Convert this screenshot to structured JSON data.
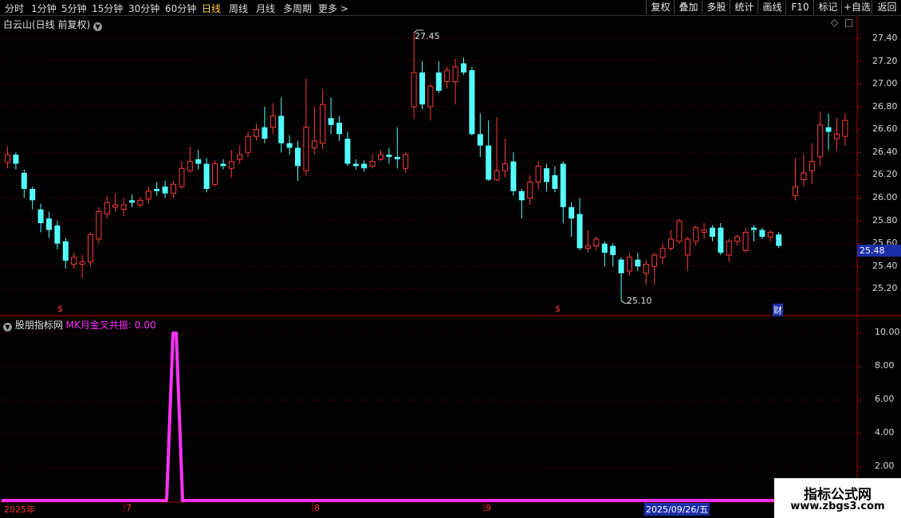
{
  "toolbar": {
    "periods": [
      "分时",
      "1分钟",
      "5分钟",
      "15分钟",
      "30分钟",
      "60分钟",
      "日线",
      "周线",
      "月线",
      "多周期",
      "更多 >"
    ],
    "active_period": "日线",
    "right_buttons": [
      "复权",
      "叠加",
      "多股",
      "统计",
      "画线",
      "F10",
      "标记",
      "+自选",
      "返回"
    ]
  },
  "chart_header": {
    "title": "白云山(日线 前复权)",
    "dropdown_icon": "chevron-down-icon"
  },
  "indicator_header": {
    "name": "股朋指标网",
    "formula": "MK月金叉共振: 0.00"
  },
  "price_axis": {
    "ticks": [
      "27.40",
      "27.20",
      "27.00",
      "26.80",
      "26.60",
      "26.40",
      "26.20",
      "26.00",
      "25.80",
      "25.60",
      "25.40",
      "25.20"
    ],
    "current_price": "25.48"
  },
  "indicator_axis": {
    "ticks": [
      "10.00",
      "8.00",
      "6.00",
      "4.00",
      "2.00"
    ]
  },
  "annotations": {
    "high": "27.45",
    "low": "25.10",
    "markers": [
      "$",
      "$",
      "财"
    ]
  },
  "date_axis": {
    "labels": [
      "2025年",
      "7",
      "8",
      "9",
      "2025/09/26/五"
    ]
  },
  "watermark": {
    "line1": "指标公式网",
    "line2": "www.zbgs3.com"
  },
  "colors": {
    "up": "#ff3b3b",
    "down": "#54ffff",
    "indicator": "#ff33ff",
    "grid": "#7a0000",
    "active": "#ffd24a"
  },
  "chart_data": {
    "type": "candlestick",
    "price_range": [
      25.1,
      27.5
    ],
    "candles": [
      [
        26.31,
        26.38,
        26.26,
        26.45
      ],
      [
        26.38,
        26.3,
        26.25,
        26.4
      ],
      [
        26.22,
        26.08,
        26.0,
        26.25
      ],
      [
        26.08,
        25.98,
        25.9,
        26.1
      ],
      [
        25.9,
        25.78,
        25.7,
        25.95
      ],
      [
        25.82,
        25.72,
        25.65,
        25.88
      ],
      [
        25.76,
        25.6,
        25.55,
        25.8
      ],
      [
        25.62,
        25.45,
        25.38,
        25.65
      ],
      [
        25.42,
        25.48,
        25.38,
        25.52
      ],
      [
        25.42,
        25.44,
        25.3,
        25.5
      ],
      [
        25.44,
        25.68,
        25.4,
        25.7
      ],
      [
        25.64,
        25.88,
        25.6,
        25.92
      ],
      [
        25.86,
        25.96,
        25.82,
        26.02
      ],
      [
        25.92,
        25.94,
        25.88,
        26.04
      ],
      [
        25.9,
        25.94,
        25.84,
        26.0
      ],
      [
        25.98,
        25.96,
        25.92,
        26.03
      ],
      [
        25.94,
        25.98,
        25.92,
        26.01
      ],
      [
        25.99,
        26.06,
        25.95,
        26.1
      ],
      [
        26.08,
        26.06,
        26.02,
        26.14
      ],
      [
        26.1,
        26.04,
        26.0,
        26.15
      ],
      [
        26.04,
        26.12,
        26.0,
        26.15
      ],
      [
        26.1,
        26.26,
        26.08,
        26.32
      ],
      [
        26.24,
        26.32,
        26.22,
        26.45
      ],
      [
        26.34,
        26.3,
        26.25,
        26.42
      ],
      [
        26.3,
        26.08,
        26.05,
        26.35
      ],
      [
        26.12,
        26.3,
        26.1,
        26.33
      ],
      [
        26.3,
        26.28,
        26.25,
        26.34
      ],
      [
        26.26,
        26.32,
        26.18,
        26.42
      ],
      [
        26.34,
        26.38,
        26.3,
        26.46
      ],
      [
        26.4,
        26.54,
        26.36,
        26.58
      ],
      [
        26.54,
        26.6,
        26.5,
        26.65
      ],
      [
        26.62,
        26.52,
        26.48,
        26.8
      ],
      [
        26.62,
        26.72,
        26.56,
        26.83
      ],
      [
        26.72,
        26.48,
        26.4,
        26.88
      ],
      [
        26.48,
        26.44,
        26.38,
        26.55
      ],
      [
        26.44,
        26.28,
        26.15,
        26.5
      ],
      [
        26.24,
        26.62,
        26.2,
        27.05
      ],
      [
        26.44,
        26.5,
        26.38,
        26.8
      ],
      [
        26.48,
        26.82,
        26.43,
        26.95
      ],
      [
        26.7,
        26.64,
        26.56,
        26.88
      ],
      [
        26.66,
        26.56,
        26.5,
        26.72
      ],
      [
        26.52,
        26.3,
        26.28,
        26.58
      ],
      [
        26.3,
        26.28,
        26.25,
        26.34
      ],
      [
        26.3,
        26.26,
        26.23,
        26.33
      ],
      [
        26.28,
        26.32,
        26.26,
        26.38
      ],
      [
        26.34,
        26.38,
        26.32,
        26.42
      ],
      [
        26.38,
        26.36,
        26.3,
        26.44
      ],
      [
        26.36,
        26.34,
        26.26,
        26.62
      ],
      [
        26.26,
        26.38,
        26.22,
        26.4
      ],
      [
        26.8,
        27.1,
        26.7,
        27.45
      ],
      [
        27.1,
        26.82,
        26.78,
        27.2
      ],
      [
        26.8,
        26.98,
        26.68,
        27.0
      ],
      [
        27.1,
        26.94,
        26.92,
        27.2
      ],
      [
        27.02,
        27.12,
        26.96,
        27.15
      ],
      [
        27.02,
        27.15,
        26.82,
        27.22
      ],
      [
        27.18,
        27.1,
        27.08,
        27.23
      ],
      [
        27.12,
        26.56,
        26.55,
        27.15
      ],
      [
        26.56,
        26.46,
        26.36,
        26.74
      ],
      [
        26.46,
        26.16,
        26.15,
        26.68
      ],
      [
        26.16,
        26.24,
        26.15,
        26.71
      ],
      [
        26.24,
        26.3,
        26.18,
        26.52
      ],
      [
        26.32,
        26.06,
        26.02,
        26.4
      ],
      [
        26.06,
        25.98,
        25.82,
        26.08
      ],
      [
        26.0,
        26.14,
        25.94,
        26.2
      ],
      [
        26.14,
        26.28,
        26.08,
        26.32
      ],
      [
        26.26,
        26.14,
        26.06,
        26.3
      ],
      [
        26.2,
        26.08,
        26.05,
        26.28
      ],
      [
        26.3,
        25.92,
        25.78,
        26.32
      ],
      [
        25.92,
        25.82,
        25.66,
        25.96
      ],
      [
        25.86,
        25.56,
        25.54,
        26.0
      ],
      [
        25.56,
        25.58,
        25.52,
        25.72
      ],
      [
        25.58,
        25.64,
        25.54,
        25.66
      ],
      [
        25.6,
        25.52,
        25.4,
        25.62
      ],
      [
        25.58,
        25.5,
        25.4,
        25.6
      ],
      [
        25.46,
        25.34,
        25.1,
        25.48
      ],
      [
        25.36,
        25.48,
        25.32,
        25.52
      ],
      [
        25.46,
        25.4,
        25.36,
        25.52
      ],
      [
        25.34,
        25.42,
        25.24,
        25.46
      ],
      [
        25.4,
        25.5,
        25.24,
        25.52
      ],
      [
        25.48,
        25.56,
        25.42,
        25.6
      ],
      [
        25.56,
        25.64,
        25.54,
        25.72
      ],
      [
        25.62,
        25.8,
        25.6,
        25.82
      ],
      [
        25.5,
        25.64,
        25.36,
        25.66
      ],
      [
        25.62,
        25.74,
        25.58,
        25.76
      ],
      [
        25.7,
        25.72,
        25.64,
        25.78
      ],
      [
        25.74,
        25.66,
        25.62,
        25.76
      ],
      [
        25.74,
        25.52,
        25.5,
        25.78
      ],
      [
        25.5,
        25.62,
        25.44,
        25.64
      ],
      [
        25.62,
        25.66,
        25.58,
        25.68
      ],
      [
        25.54,
        25.7,
        25.52,
        25.74
      ],
      [
        25.74,
        25.72,
        25.62,
        25.76
      ],
      [
        25.72,
        25.66,
        25.64,
        25.74
      ],
      [
        25.66,
        25.7,
        25.62,
        25.72
      ],
      [
        25.68,
        25.58,
        25.56,
        25.7
      ],
      null,
      [
        26.02,
        26.1,
        25.98,
        26.35
      ],
      [
        26.16,
        26.22,
        26.1,
        26.38
      ],
      [
        26.24,
        26.32,
        26.12,
        26.48
      ],
      [
        26.36,
        26.64,
        26.28,
        26.76
      ],
      [
        26.62,
        26.58,
        26.42,
        26.74
      ],
      [
        26.52,
        26.56,
        26.42,
        26.7
      ],
      [
        26.54,
        26.68,
        26.46,
        26.74
      ]
    ],
    "indicator": {
      "name": "MK月金叉共振",
      "range": [
        0,
        10
      ],
      "spike_index": 20,
      "spike_value": 10,
      "last_value": 0
    }
  }
}
